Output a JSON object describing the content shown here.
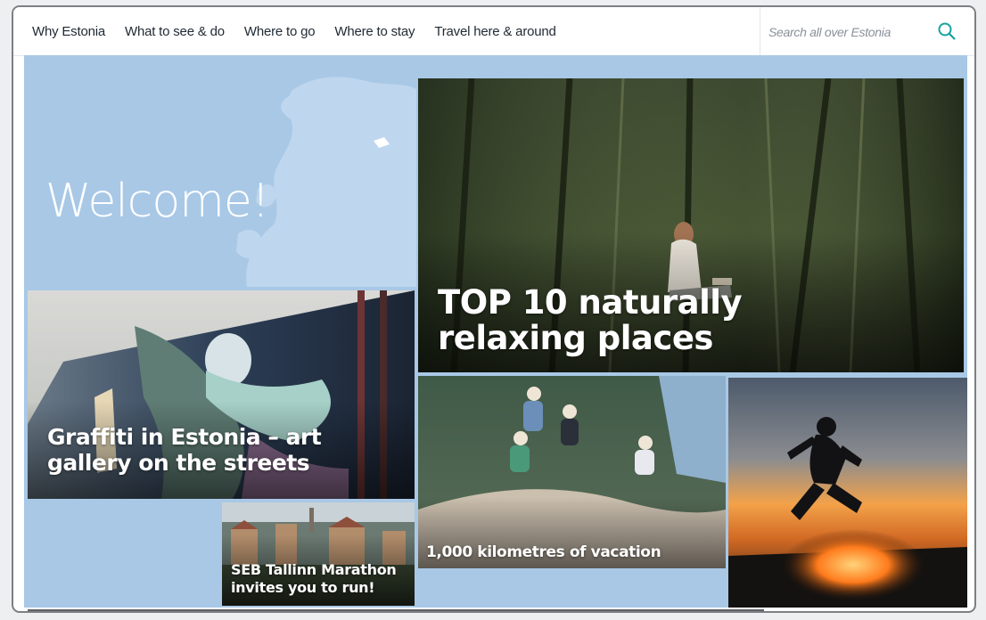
{
  "nav": {
    "items": [
      "Why Estonia",
      "What to see & do",
      "Where to go",
      "Where to stay",
      "Travel here & around"
    ]
  },
  "search": {
    "placeholder": "Search all over Estonia"
  },
  "hero": {
    "welcome": "Welcome!"
  },
  "cards": {
    "relaxing": {
      "title": "TOP 10 naturally relaxing places"
    },
    "graffiti": {
      "title": "Graffiti in Estonia – art gallery on the streets"
    },
    "marathon": {
      "title": "SEB Tallinn Marathon invites you to run!"
    },
    "vacation": {
      "title": "1,000 kilometres of vacation"
    },
    "bonfire": {
      "title": ""
    }
  },
  "colors": {
    "accent": "#16a3a0",
    "sky": "#a8c8e6"
  },
  "icons": {
    "search": "search-icon",
    "map": "europe-map"
  }
}
